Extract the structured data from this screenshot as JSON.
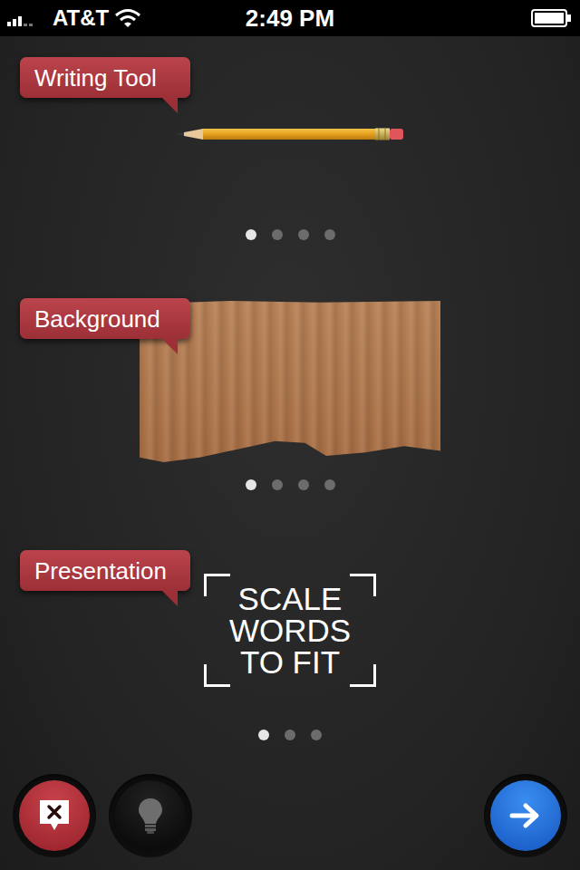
{
  "status_bar": {
    "carrier": "AT&T",
    "time": "2:49 PM"
  },
  "sections": [
    {
      "label": "Writing Tool",
      "kind": "pencil",
      "dots": [
        {
          "selected": true
        },
        {
          "selected": false
        },
        {
          "selected": false
        },
        {
          "selected": false
        }
      ]
    },
    {
      "label": "Background",
      "kind": "cardboard",
      "dots": [
        {
          "selected": true
        },
        {
          "selected": false
        },
        {
          "selected": false
        },
        {
          "selected": false
        }
      ]
    },
    {
      "label": "Presentation",
      "kind": "text",
      "preview_lines": [
        "SCALE",
        "WORDS",
        "TO FIT"
      ],
      "dots": [
        {
          "selected": true
        },
        {
          "selected": false
        },
        {
          "selected": false
        }
      ]
    }
  ]
}
